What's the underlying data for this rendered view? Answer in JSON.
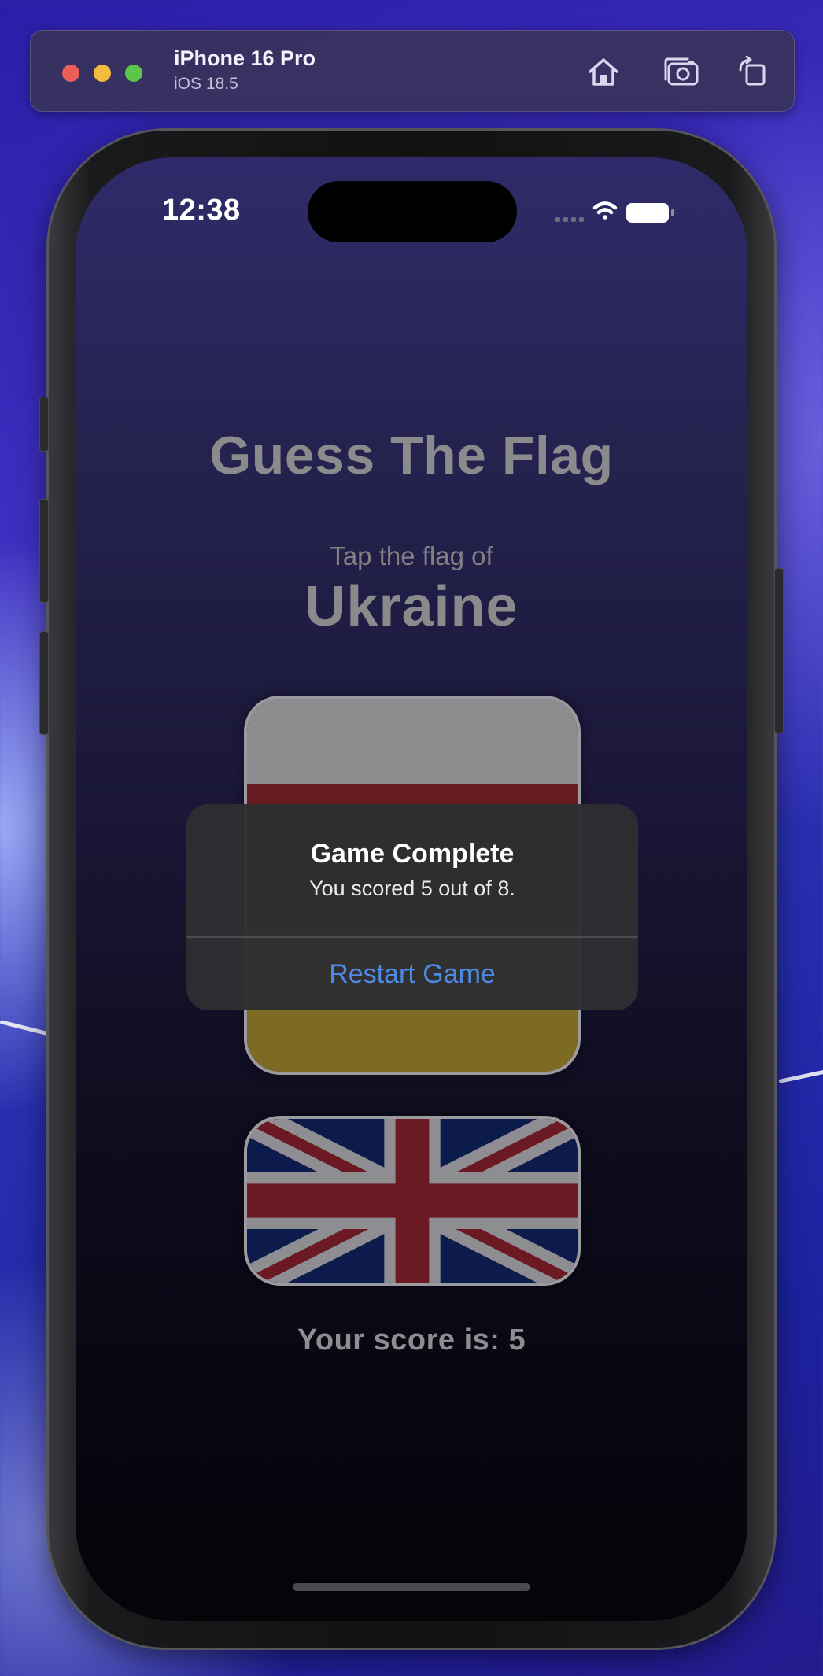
{
  "simulator": {
    "device_name": "iPhone 16 Pro",
    "os_version": "iOS 18.5",
    "icons": [
      "home-icon",
      "screenshot-icon",
      "rotate-icon"
    ]
  },
  "status_bar": {
    "time": "12:38",
    "icons": [
      "cellular-icon",
      "wifi-icon",
      "battery-icon"
    ]
  },
  "game": {
    "title": "Guess The Flag",
    "prompt": "Tap the flag of",
    "country": "Ukraine",
    "score_text": "Your score is: 5"
  },
  "flags": [
    {
      "name": "top-flag-button",
      "colors": [
        "#e9e9e9",
        "#8a1a24",
        "#e0c024"
      ]
    },
    {
      "name": "union-jack-flag-button",
      "colors": [
        "#012169",
        "#ffffff",
        "#c8102e"
      ]
    }
  ],
  "alert": {
    "title": "Game Complete",
    "message": "You scored 5 out of 8.",
    "button_label": "Restart Game",
    "button_color": "#4d8ae5"
  }
}
